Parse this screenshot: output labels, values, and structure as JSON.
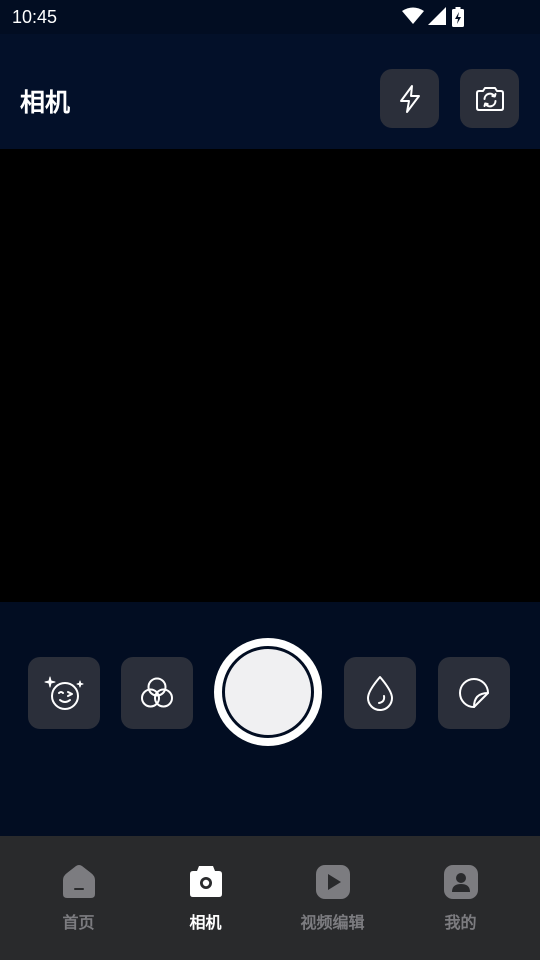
{
  "status_bar": {
    "time": "10:45"
  },
  "header": {
    "title": "相机"
  },
  "colors": {
    "background": "#020d22",
    "button_bg": "#2b2f3a",
    "nav_bg": "#292a2c",
    "nav_active": "#ffffff",
    "nav_inactive": "#7c7c80"
  },
  "header_buttons": [
    {
      "icon": "flash-icon"
    },
    {
      "icon": "switch-camera-icon"
    }
  ],
  "tools": [
    {
      "icon": "beauty-face-icon"
    },
    {
      "icon": "filter-icon"
    },
    {
      "icon": "shutter-button"
    },
    {
      "icon": "color-drop-icon"
    },
    {
      "icon": "sticker-icon"
    }
  ],
  "bottom_nav": {
    "active_index": 1,
    "items": [
      {
        "label": "首页",
        "icon": "home-icon"
      },
      {
        "label": "相机",
        "icon": "camera-icon"
      },
      {
        "label": "视频编辑",
        "icon": "video-play-icon"
      },
      {
        "label": "我的",
        "icon": "profile-icon"
      }
    ]
  }
}
